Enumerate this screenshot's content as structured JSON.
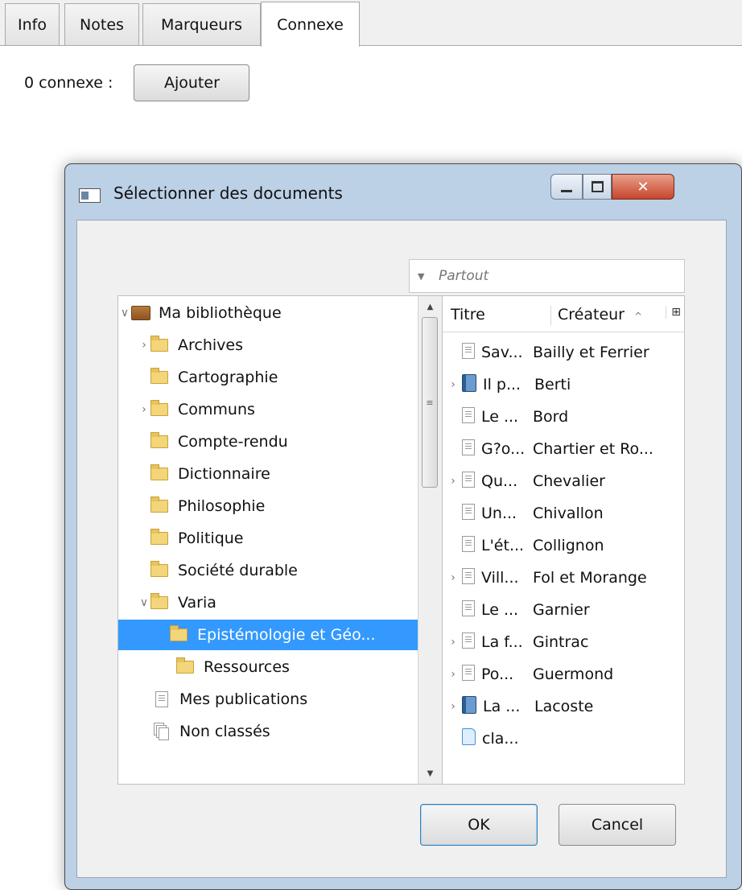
{
  "tabs": [
    {
      "label": "Info",
      "active": false
    },
    {
      "label": "Notes",
      "active": false
    },
    {
      "label": "Marqueurs",
      "active": false
    },
    {
      "label": "Connexe",
      "active": true
    }
  ],
  "related": {
    "count_label": "0 connexe :",
    "add_button": "Ajouter"
  },
  "dialog": {
    "title": "Sélectionner des documents",
    "search": {
      "placeholder": "Partout"
    },
    "tree": {
      "root": "Ma bibliothèque",
      "items": [
        {
          "label": "Archives",
          "expandable": true
        },
        {
          "label": "Cartographie",
          "expandable": false
        },
        {
          "label": "Communs",
          "expandable": true
        },
        {
          "label": "Compte-rendu",
          "expandable": false
        },
        {
          "label": "Dictionnaire",
          "expandable": false
        },
        {
          "label": "Philosophie",
          "expandable": false
        },
        {
          "label": "Politique",
          "expandable": false
        },
        {
          "label": "Société durable",
          "expandable": false
        },
        {
          "label": "Varia",
          "expandable": true,
          "expanded": true
        }
      ],
      "varia_children": [
        {
          "label": "Epistémologie et Géo...",
          "selected": true
        },
        {
          "label": "Ressources",
          "selected": false
        }
      ],
      "publications": "Mes publications",
      "unfiled": "Non classés"
    },
    "items_table": {
      "columns": {
        "title": "Titre",
        "creator": "Créateur"
      },
      "sort": "creator ascending",
      "rows": [
        {
          "title": "Sav...",
          "creator": "Bailly et Ferrier",
          "icon": "document-icon",
          "expandable": false
        },
        {
          "title": "Il p...",
          "creator": "Berti",
          "icon": "book-icon",
          "expandable": true
        },
        {
          "title": "Le ...",
          "creator": "Bord",
          "icon": "document-icon",
          "expandable": false
        },
        {
          "title": "G?o...",
          "creator": "Chartier et Ro...",
          "icon": "document-icon",
          "expandable": false
        },
        {
          "title": "Qu...",
          "creator": "Chevalier",
          "icon": "document-icon",
          "expandable": true
        },
        {
          "title": "Un...",
          "creator": "Chivallon",
          "icon": "document-icon",
          "expandable": false
        },
        {
          "title": "L'ét...",
          "creator": "Collignon",
          "icon": "document-icon",
          "expandable": false
        },
        {
          "title": "Vill...",
          "creator": "Fol et Morange",
          "icon": "document-icon",
          "expandable": true
        },
        {
          "title": "Le ...",
          "creator": "Garnier",
          "icon": "document-icon",
          "expandable": false
        },
        {
          "title": "La f...",
          "creator": "Gintrac",
          "icon": "document-icon",
          "expandable": true
        },
        {
          "title": "Po...",
          "creator": "Guermond",
          "icon": "document-icon",
          "expandable": true
        },
        {
          "title": "La ...",
          "creator": "Lacoste",
          "icon": "book-icon",
          "expandable": true
        },
        {
          "title": "cla...",
          "creator": "",
          "icon": "note-icon",
          "expandable": false
        }
      ]
    },
    "buttons": {
      "ok": "OK",
      "cancel": "Cancel"
    },
    "colors": {
      "selection": "#3399ff",
      "dialog_frame": "#bcd0e6"
    }
  }
}
